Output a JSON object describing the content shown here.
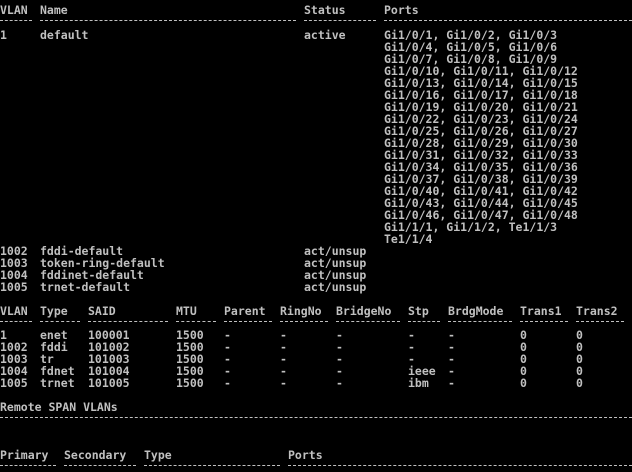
{
  "colors": {
    "background": "#000000",
    "text": "#c0c0c0"
  },
  "vlan_brief": {
    "headers": {
      "vlan": "VLAN",
      "name": "Name",
      "status": "Status",
      "ports": "Ports"
    },
    "rows": [
      {
        "vlan": "1",
        "name": "default",
        "status": "active",
        "ports_lines": [
          "Gi1/0/1, Gi1/0/2, Gi1/0/3",
          "Gi1/0/4, Gi1/0/5, Gi1/0/6",
          "Gi1/0/7, Gi1/0/8, Gi1/0/9",
          "Gi1/0/10, Gi1/0/11, Gi1/0/12",
          "Gi1/0/13, Gi1/0/14, Gi1/0/15",
          "Gi1/0/16, Gi1/0/17, Gi1/0/18",
          "Gi1/0/19, Gi1/0/20, Gi1/0/21",
          "Gi1/0/22, Gi1/0/23, Gi1/0/24",
          "Gi1/0/25, Gi1/0/26, Gi1/0/27",
          "Gi1/0/28, Gi1/0/29, Gi1/0/30",
          "Gi1/0/31, Gi1/0/32, Gi1/0/33",
          "Gi1/0/34, Gi1/0/35, Gi1/0/36",
          "Gi1/0/37, Gi1/0/38, Gi1/0/39",
          "Gi1/0/40, Gi1/0/41, Gi1/0/42",
          "Gi1/0/43, Gi1/0/44, Gi1/0/45",
          "Gi1/0/46, Gi1/0/47, Gi1/0/48",
          "Gi1/1/1, Gi1/1/2, Te1/1/3",
          "Te1/1/4"
        ]
      },
      {
        "vlan": "1002",
        "name": "fddi-default",
        "status": "act/unsup",
        "ports_lines": []
      },
      {
        "vlan": "1003",
        "name": "token-ring-default",
        "status": "act/unsup",
        "ports_lines": []
      },
      {
        "vlan": "1004",
        "name": "fddinet-default",
        "status": "act/unsup",
        "ports_lines": []
      },
      {
        "vlan": "1005",
        "name": "trnet-default",
        "status": "act/unsup",
        "ports_lines": []
      }
    ]
  },
  "vlan_detail": {
    "headers": {
      "vlan": "VLAN",
      "type": "Type",
      "said": "SAID",
      "mtu": "MTU",
      "parent": "Parent",
      "ringno": "RingNo",
      "bridgeno": "BridgeNo",
      "stp": "Stp",
      "brdgmode": "BrdgMode",
      "trans1": "Trans1",
      "trans2": "Trans2"
    },
    "rows": [
      {
        "vlan": "1",
        "type": "enet",
        "said": "100001",
        "mtu": "1500",
        "parent": "-",
        "ringno": "-",
        "bridgeno": "-",
        "stp": "-",
        "brdgmode": "-",
        "trans1": "0",
        "trans2": "0"
      },
      {
        "vlan": "1002",
        "type": "fddi",
        "said": "101002",
        "mtu": "1500",
        "parent": "-",
        "ringno": "-",
        "bridgeno": "-",
        "stp": "-",
        "brdgmode": "-",
        "trans1": "0",
        "trans2": "0"
      },
      {
        "vlan": "1003",
        "type": "tr",
        "said": "101003",
        "mtu": "1500",
        "parent": "-",
        "ringno": "-",
        "bridgeno": "-",
        "stp": "-",
        "brdgmode": "-",
        "trans1": "0",
        "trans2": "0"
      },
      {
        "vlan": "1004",
        "type": "fdnet",
        "said": "101004",
        "mtu": "1500",
        "parent": "-",
        "ringno": "-",
        "bridgeno": "-",
        "stp": "ieee",
        "brdgmode": "-",
        "trans1": "0",
        "trans2": "0"
      },
      {
        "vlan": "1005",
        "type": "trnet",
        "said": "101005",
        "mtu": "1500",
        "parent": "-",
        "ringno": "-",
        "bridgeno": "-",
        "stp": "ibm",
        "brdgmode": "-",
        "trans1": "0",
        "trans2": "0"
      }
    ]
  },
  "remote_span": {
    "title": "Remote SPAN VLANs"
  },
  "private_vlan": {
    "headers": {
      "primary": "Primary",
      "secondary": "Secondary",
      "type": "Type",
      "ports": "Ports"
    }
  }
}
